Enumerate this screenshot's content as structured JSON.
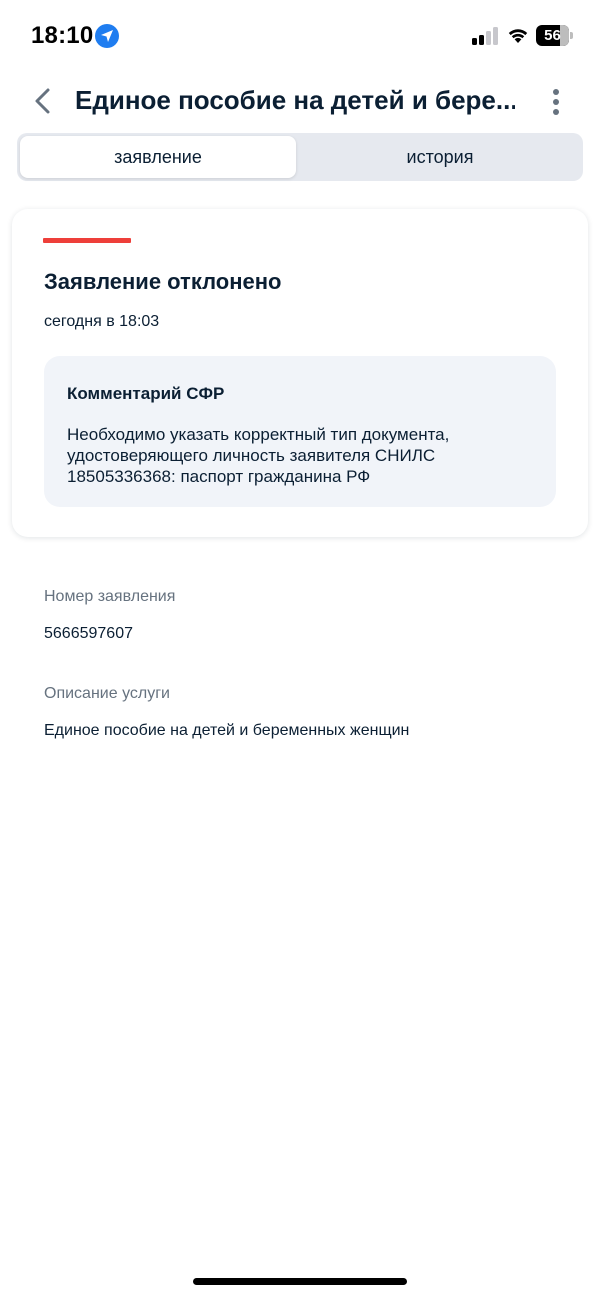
{
  "status_bar": {
    "time": "18:10",
    "battery": "56"
  },
  "header": {
    "title": "Единое пособие на детей и бере..."
  },
  "tabs": [
    {
      "label": "заявление",
      "active": true
    },
    {
      "label": "история",
      "active": false
    }
  ],
  "status_card": {
    "title": "Заявление отклонено",
    "date": "сегодня в 18:03",
    "status_color": "#ee3f3a",
    "comment": {
      "title": "Комментарий СФР",
      "text": "Необходимо указать корректный тип документа, удостоверяющего личность заявителя СНИЛС 18505336368: паспорт гражданина РФ"
    }
  },
  "info": {
    "number_label": "Номер заявления",
    "number_value": "5666597607",
    "service_label": "Описание услуги",
    "service_value": "Единое пособие на детей и беременных женщин"
  }
}
